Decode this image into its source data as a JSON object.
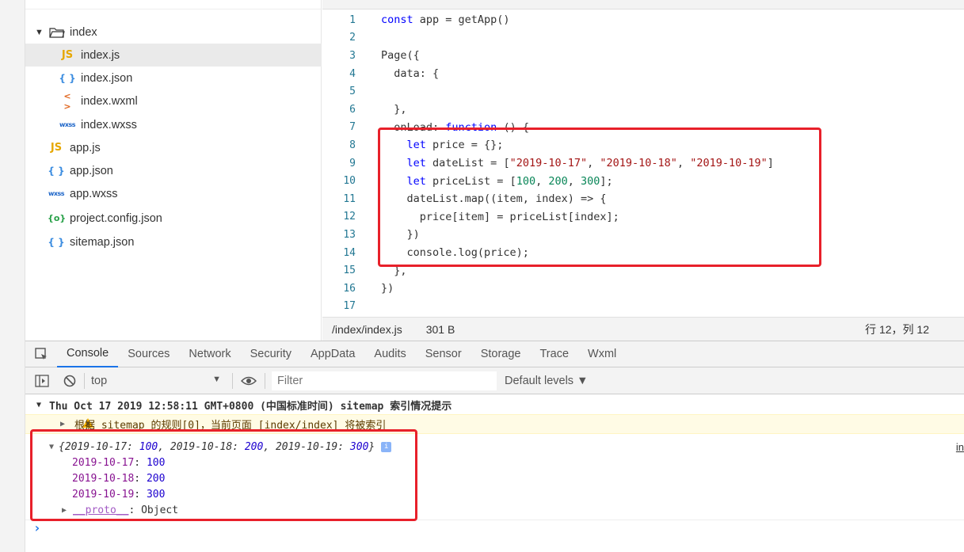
{
  "file_tree": {
    "folder": "index",
    "children": [
      {
        "icon": "JS",
        "type": "js",
        "name": "index.js",
        "selected": true
      },
      {
        "icon": "{ }",
        "type": "json",
        "name": "index.json"
      },
      {
        "icon": "< >",
        "type": "wxml",
        "name": "index.wxml"
      },
      {
        "icon": "wxss",
        "type": "wxss",
        "name": "index.wxss"
      }
    ],
    "root_files": [
      {
        "icon": "JS",
        "type": "js",
        "name": "app.js"
      },
      {
        "icon": "{ }",
        "type": "json",
        "name": "app.json"
      },
      {
        "icon": "wxss",
        "type": "wxss",
        "name": "app.wxss"
      },
      {
        "icon": "{o}",
        "type": "cfg",
        "name": "project.config.json"
      },
      {
        "icon": "{ }",
        "type": "json",
        "name": "sitemap.json"
      }
    ]
  },
  "editor": {
    "tab": "index.js",
    "lines": [
      {
        "n": "1",
        "html": "<span class='kw'>const</span> app = getApp()"
      },
      {
        "n": "2",
        "html": ""
      },
      {
        "n": "3",
        "html": "Page({"
      },
      {
        "n": "4",
        "html": "  data: {"
      },
      {
        "n": "5",
        "html": ""
      },
      {
        "n": "6",
        "html": "  },"
      },
      {
        "n": "7",
        "html": "  onLoad: <span class='kw'>function</span> () {"
      },
      {
        "n": "8",
        "html": "    <span class='kw'>let</span> price = {};"
      },
      {
        "n": "9",
        "html": "    <span class='kw'>let</span> dateList = [<span class='str'>\"2019-10-17\"</span>, <span class='str'>\"2019-10-18\"</span>, <span class='str'>\"2019-10-19\"</span>]"
      },
      {
        "n": "10",
        "html": "    <span class='kw'>let</span> priceList = [<span class='num'>100</span>, <span class='num'>200</span>, <span class='num'>300</span>];"
      },
      {
        "n": "11",
        "html": "    dateList.map((item, index) => {"
      },
      {
        "n": "12",
        "html": "      price[item] = priceList[index];"
      },
      {
        "n": "13",
        "html": "    })"
      },
      {
        "n": "14",
        "html": "    console.log(price);"
      },
      {
        "n": "15",
        "html": "  },"
      },
      {
        "n": "16",
        "html": "})"
      },
      {
        "n": "17",
        "html": ""
      }
    ]
  },
  "statusbar": {
    "path": "/index/index.js",
    "size": "301 B",
    "position": "行 12，列 12"
  },
  "devtools": {
    "tabs": [
      "Console",
      "Sources",
      "Network",
      "Security",
      "AppData",
      "Audits",
      "Sensor",
      "Storage",
      "Trace",
      "Wxml"
    ],
    "active_tab": "Console",
    "context": "top",
    "filter_placeholder": "Filter",
    "levels": "Default levels ▼"
  },
  "console": {
    "group_header": "Thu Oct 17 2019 12:58:11 GMT+0800 (中国标准时间) sitemap 索引情况提示",
    "warning": "根据 sitemap 的规则[0]，当前页面 [index/index] 将被索引",
    "object_preview_parts": [
      {
        "k": "2019-10-17",
        "v": "100"
      },
      {
        "k": "2019-10-18",
        "v": "200"
      },
      {
        "k": "2019-10-19",
        "v": "300"
      }
    ],
    "props": [
      {
        "k": "2019-10-17",
        "v": "100"
      },
      {
        "k": "2019-10-18",
        "v": "200"
      },
      {
        "k": "2019-10-19",
        "v": "300"
      }
    ],
    "proto_label": "__proto__",
    "proto_value": "Object",
    "source_link": "in",
    "prompt": "›"
  }
}
